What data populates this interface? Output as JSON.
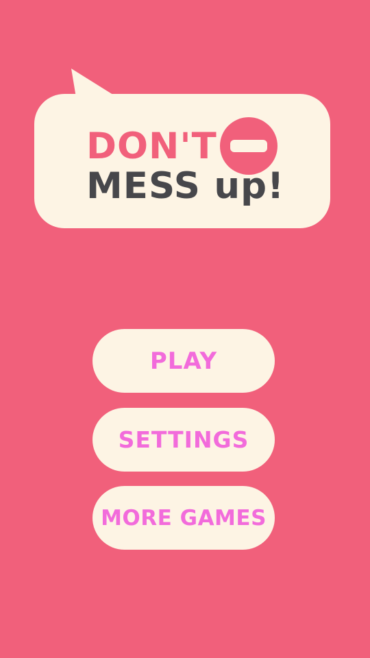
{
  "logo": {
    "line1": "DON'T",
    "line2": "MESS up!",
    "icon": "minus-icon"
  },
  "menu": {
    "play_label": "PLAY",
    "settings_label": "SETTINGS",
    "more_games_label": "MORE GAMES"
  },
  "colors": {
    "background": "#F1607B",
    "cream": "#FDF4E4",
    "dark_text": "#47474B",
    "button_text": "#F26BDB"
  }
}
